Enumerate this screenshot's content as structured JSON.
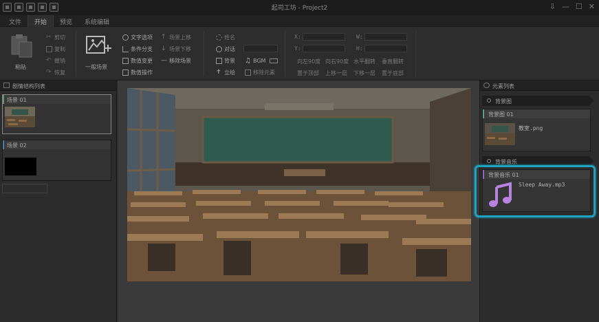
{
  "window": {
    "title": "起司工坊 - Project2",
    "controls": [
      "⇩",
      "—",
      "☐",
      "✕"
    ]
  },
  "menu": [
    "文件",
    "开始",
    "预览",
    "系统编辑"
  ],
  "ribbon": {
    "paste": "粘贴",
    "cut": "剪切",
    "copy": "复制",
    "undo": "撤销",
    "redo": "恢复",
    "new_scene": "一般场景",
    "text_option": "文字选项",
    "condition_branch": "条件分支",
    "value_change": "数值变更",
    "value_operation": "数值操作",
    "scene_up": "场景上移",
    "scene_down": "场景下移",
    "remove_scene": "移除场景",
    "name": "姓名",
    "dialog": "对话",
    "background": "背景",
    "standing": "立绘",
    "bgm": "BGM",
    "remove_element": "移除元素",
    "coord_x": "X:",
    "coord_y": "Y:",
    "coord_w": "W:",
    "coord_h": "H:",
    "rotate_left": "向左90度",
    "rotate_right": "向右90度",
    "flip_h": "水平翻转",
    "flip_v": "垂直翻转",
    "to_bottom": "置于顶部",
    "move_up": "上移一层",
    "move_down": "下移一层",
    "to_top": "置于底部"
  },
  "left_panel": {
    "title": "剧情结构列表",
    "scenes": [
      {
        "label": "场景 01"
      },
      {
        "label": "场景 02"
      }
    ]
  },
  "right_panel": {
    "title": "元素列表",
    "sections": {
      "background": "背景图",
      "music": "背景音乐"
    },
    "bg_card": {
      "header": "背景图 01",
      "file": "教室.png"
    },
    "music_card": {
      "header": "背景音乐 01",
      "file": "Sleep Away.mp3"
    }
  },
  "colors": {
    "highlight": "#1fa3be",
    "music_icon": "#b783e0",
    "chalkboard": "#2f5a4e"
  },
  "icons": [
    "paste-icon",
    "cut-icon",
    "copy-icon",
    "undo-icon",
    "redo-icon",
    "new-scene-icon",
    "music-note-icon"
  ]
}
